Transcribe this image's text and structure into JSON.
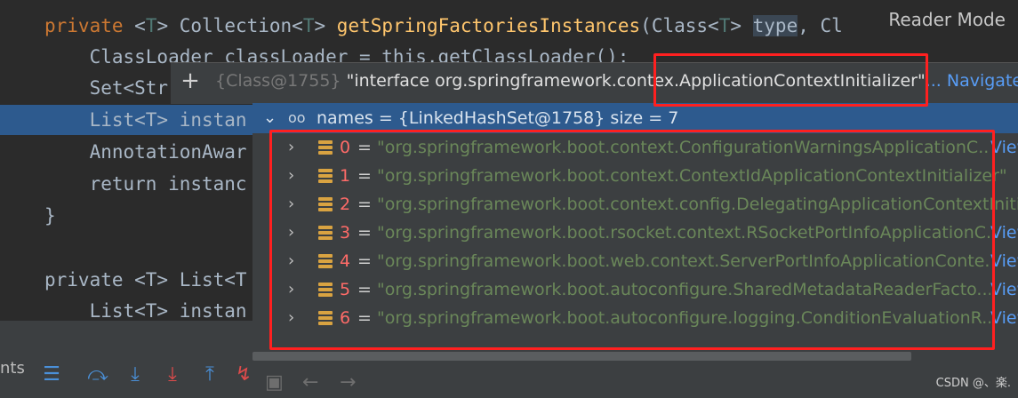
{
  "editor": {
    "lines": [
      {
        "parts": [
          "private",
          " <",
          "T",
          "> Collection<",
          "T",
          "> ",
          "getSpringFactoriesInstances",
          "(Class<",
          "T",
          "> ",
          "type",
          ", Cl"
        ]
      },
      {
        "text": "    ClassLoader classLoader = this.getClassLoader();"
      },
      {
        "text": "    Set<Str"
      },
      {
        "text": "    List<T> instan"
      },
      {
        "text": "    AnnotationAwar"
      },
      {
        "text": "    return instanc"
      },
      {
        "text": "}"
      },
      {
        "text": ""
      },
      {
        "text": "private <T> List<T"
      },
      {
        "text": "    List<T> instan"
      }
    ]
  },
  "reader_mode_label": "Reader Mode",
  "popup": {
    "header_gray": "{Class@1755}",
    "header_value_prefix": "\"interface org.springframework.contex",
    "header_value_highlight": ".ApplicationContextInitializer\"",
    "header_ellipsis": "...",
    "navigate_label": "Navigate",
    "root_label": "names = {LinkedHashSet@1758}  size = 7",
    "items": [
      {
        "index": "0",
        "value": "\"org.springframework.boot.context.ConfigurationWarningsApplicationC...",
        "view": "View"
      },
      {
        "index": "1",
        "value": "\"org.springframework.boot.context.ContextIdApplicationContextInitializer\"",
        "view": ""
      },
      {
        "index": "2",
        "value": "\"org.springframework.boot.context.config.DelegatingApplicationContextInitia",
        "view": ""
      },
      {
        "index": "3",
        "value": "\"org.springframework.boot.rsocket.context.RSocketPortInfoApplicationC...",
        "view": "View"
      },
      {
        "index": "4",
        "value": "\"org.springframework.boot.web.context.ServerPortInfoApplicationConte...",
        "view": "View"
      },
      {
        "index": "5",
        "value": "\"org.springframework.boot.autoconfigure.SharedMetadataReaderFacto...",
        "view": "View"
      },
      {
        "index": "6",
        "value": "\"org.springframework.boot.autoconfigure.logging.ConditionEvaluationR...",
        "view": "View"
      }
    ]
  },
  "debug_toolbar": {
    "label": "nts"
  },
  "watermark": "CSDN @、楽."
}
